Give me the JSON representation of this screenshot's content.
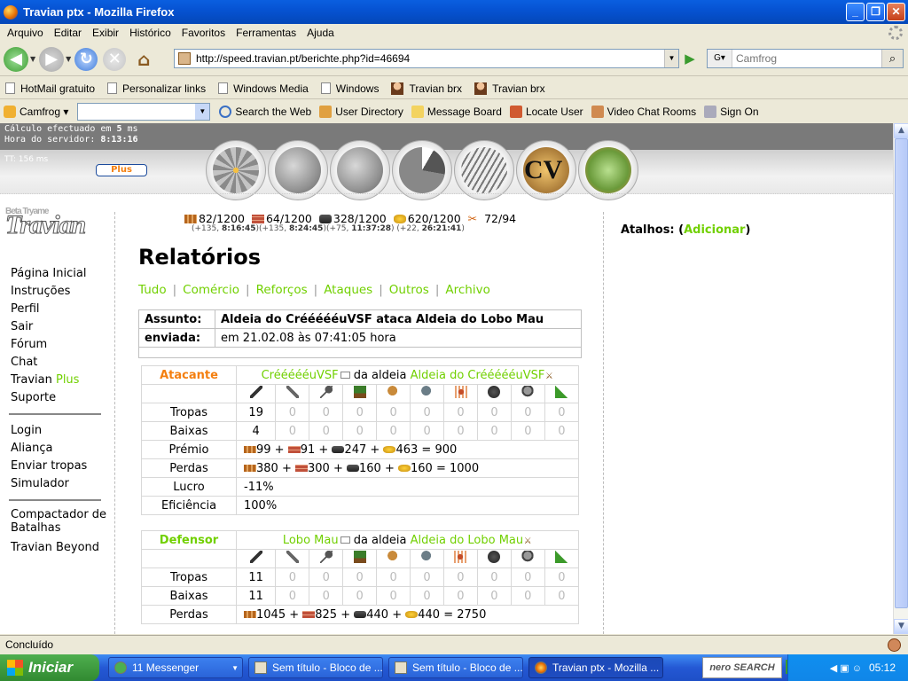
{
  "window": {
    "title": "Travian ptx - Mozilla Firefox"
  },
  "menu": [
    "Arquivo",
    "Editar",
    "Exibir",
    "Histórico",
    "Favoritos",
    "Ferramentas",
    "Ajuda"
  ],
  "nav": {
    "url": "http://speed.travian.pt/berichte.php?id=46694",
    "search_placeholder": "Camfrog"
  },
  "bookmarks": [
    "HotMail gratuito",
    "Personalizar links",
    "Windows Media",
    "Windows",
    "Travian brx",
    "Travian brx"
  ],
  "camfrog_toolbar": {
    "brand": "Camfrog",
    "items": [
      "Search the Web",
      "User Directory",
      "Message Board",
      "Locate User",
      "Video Chat Rooms",
      "Sign On"
    ]
  },
  "page": {
    "calc_prefix": "Cálculo efectuado em ",
    "calc_value": "5",
    "calc_suffix": " ms",
    "server_time_label": "Hora do servidor: ",
    "server_time": "8:13:16",
    "tt": "TT: 156 ms",
    "plus_label": "Plus",
    "logo_small": "Beta Tryame",
    "logo": "Travian",
    "sidebar": {
      "group1": [
        "Página Inicial",
        "Instruções",
        "Perfil",
        "Sair",
        "Fórum",
        "Chat"
      ],
      "travian": "Travian ",
      "plus": "Plus",
      "suporte": "Suporte",
      "group2": [
        "Login",
        "Aliança",
        "Enviar tropas",
        "Simulador"
      ],
      "group3": [
        "Compactador de Batalhas",
        "Travian Beyond"
      ]
    },
    "resources": {
      "wood": "82/1200",
      "clay": "64/1200",
      "iron": "328/1200",
      "crop": "620/1200",
      "pop": "72/94",
      "prod_wood": "(+135, ",
      "prod_wood_t": "8:16:45",
      "prod_clay": ")(+135, ",
      "prod_clay_t": "8:24:45",
      "prod_iron": ")(+75, ",
      "prod_iron_t": "11:37:28",
      "prod_crop": ") (+22, ",
      "prod_crop_t": "26:21:41",
      "prod_end": ")"
    },
    "heading": "Relatórios",
    "filters": [
      "Tudo",
      "Comércio",
      "Reforços",
      "Ataques",
      "Outros",
      "Archivo"
    ],
    "report": {
      "subject_label": "Assunto:",
      "subject": "Aldeia do CréééééuVSF ataca Aldeia do Lobo Mau",
      "sent_label": "enviada:",
      "sent": "em 21.02.08 às 07:41:05 hora"
    },
    "attacker": {
      "role": "Atacante",
      "player": "CréééééuVSF",
      "from": " da aldeia ",
      "village": "Aldeia do CréééééuVSF",
      "troops_label": "Tropas",
      "troops": [
        "19",
        "0",
        "0",
        "0",
        "0",
        "0",
        "0",
        "0",
        "0",
        "0"
      ],
      "losses_label": "Baixas",
      "losses": [
        "4",
        "0",
        "0",
        "0",
        "0",
        "0",
        "0",
        "0",
        "0",
        "0"
      ],
      "bounty_label": "Prémio",
      "bounty": {
        "wood": "99",
        "clay": "91",
        "iron": "247",
        "crop": "463",
        "total": "900"
      },
      "lost_label": "Perdas",
      "lost": {
        "wood": "380",
        "clay": "300",
        "iron": "160",
        "crop": "160",
        "total": "1000"
      },
      "profit_label": "Lucro",
      "profit": "-11%",
      "eff_label": "Eficiência",
      "eff": "100%"
    },
    "defender": {
      "role": "Defensor",
      "player": "Lobo Mau",
      "from": " da aldeia ",
      "village": "Aldeia do Lobo Mau",
      "troops_label": "Tropas",
      "troops": [
        "11",
        "0",
        "0",
        "0",
        "0",
        "0",
        "0",
        "0",
        "0",
        "0"
      ],
      "losses_label": "Baixas",
      "losses": [
        "11",
        "0",
        "0",
        "0",
        "0",
        "0",
        "0",
        "0",
        "0",
        "0"
      ],
      "lost_label": "Perdas",
      "lost": {
        "wood": "1045",
        "clay": "825",
        "iron": "440",
        "crop": "440",
        "total": "2750"
      }
    },
    "shortcuts": {
      "label": "Atalhos: (",
      "add": "Adicionar",
      "end": ")"
    }
  },
  "status": "Concluído",
  "taskbar": {
    "start": "Iniciar",
    "items": [
      "11 Messenger",
      "Sem título - Bloco de ...",
      "Sem título - Bloco de ...",
      "Travian ptx - Mozilla ..."
    ],
    "nero": "nero SEARCH",
    "clock": "05:12"
  }
}
